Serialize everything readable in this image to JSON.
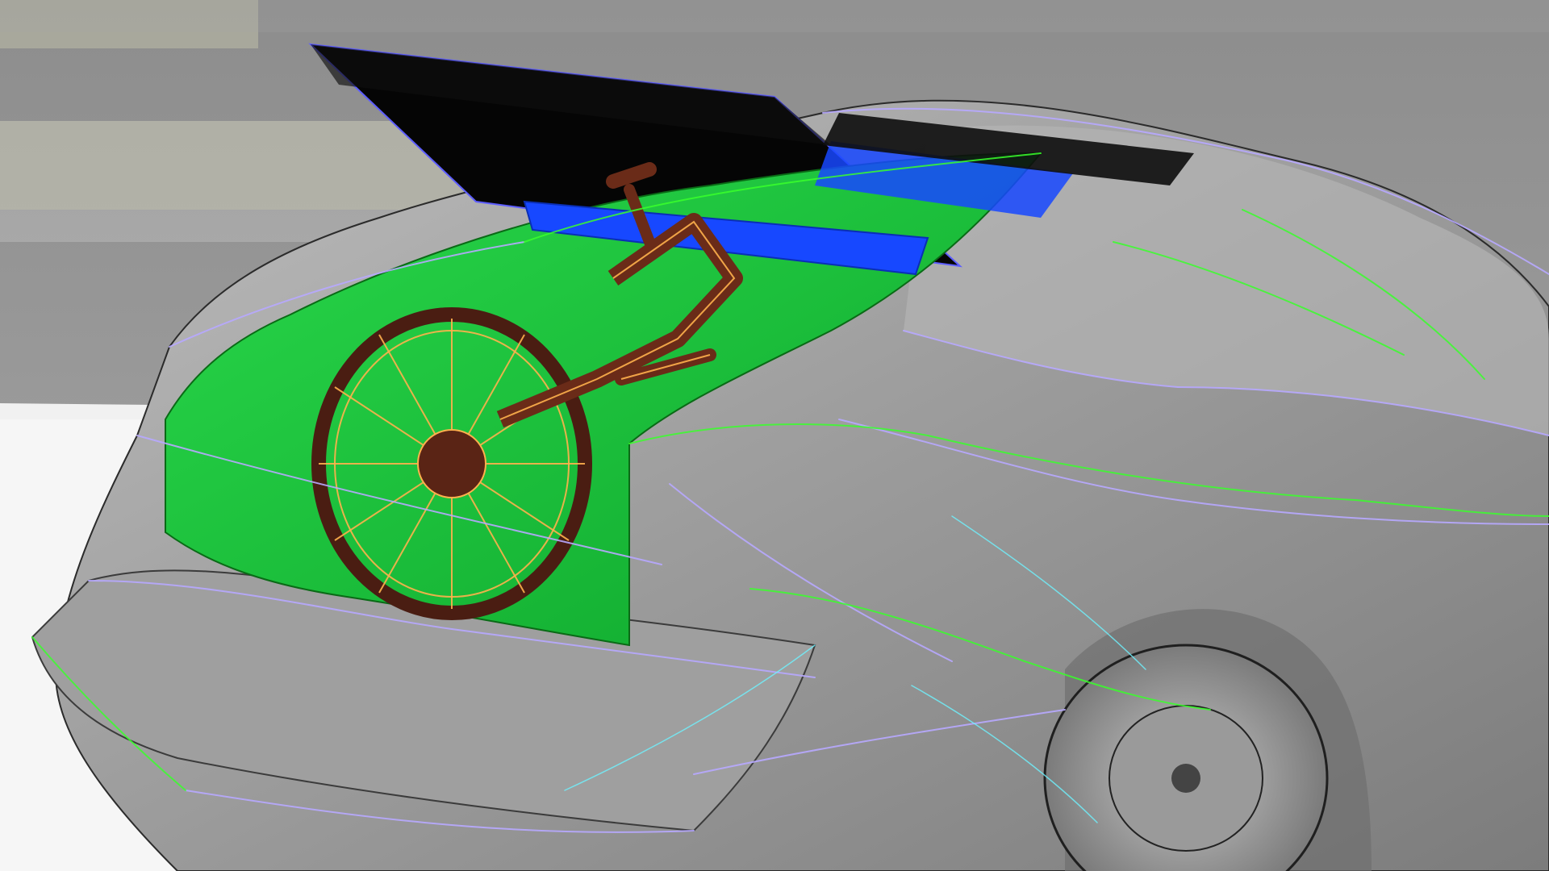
{
  "viewport": {
    "background_wall": "#8e8e8e",
    "background_stripe": "#c9c9b9",
    "floor": "#e9e9e9",
    "car_body": "#a9a9a9",
    "car_body_dark": "#8a8a8a",
    "trunk_interior": "#1fce3c",
    "trunk_edge": "#11b81f",
    "rear_window": "#000000",
    "wire_purple": "#b7a8ff",
    "wire_green": "#39ff2b",
    "wire_cyan": "#6ef3ff",
    "bike_tire": "#4a1d12",
    "bike_frame": "#6a2b18",
    "bike_wire": "#ffb14d",
    "panel_blue": "#1144ff",
    "icon_names": [
      "car-body-icon",
      "bicycle-icon",
      "trunk-icon",
      "wireframe-icon"
    ]
  }
}
